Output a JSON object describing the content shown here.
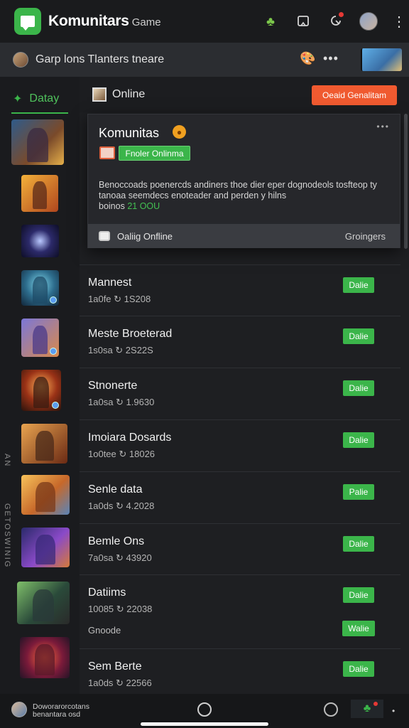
{
  "app": {
    "title": "Komunitars",
    "subtitle": "Game"
  },
  "channel": {
    "title": "Garp lons Tlanters tneare",
    "more": "•••"
  },
  "sidebar": {
    "tab_label": "Datay",
    "vertical_text_1": "AN",
    "vertical_text_2": "GETOSWINIG"
  },
  "main": {
    "header_title": "Online",
    "header_button": "Oeaid Genalitam"
  },
  "popup": {
    "title": "Komunitas",
    "badge": "Fnoler Onlinma",
    "dots": "•••",
    "desc_line1": "Benoccoads poenercds andiners thoe dier eper dognodeols tosfteop ty",
    "desc_line2": "tanoaa seemdecs enoteader and perden y hilns",
    "desc_line3_prefix": "boinos",
    "desc_line3_green": "21 OOU",
    "footer_left": "Oaliig Onfline",
    "footer_right": "Groingers"
  },
  "rows": [
    {
      "name": "Mannest",
      "meta": "1a0fe ↻ 1S208",
      "pill": "Dalie"
    },
    {
      "name": "Meste Broeterad",
      "meta": "1s0sa ↻ 2S22S",
      "pill": "Dalie"
    },
    {
      "name": "Stnonerte",
      "meta": "1a0sa ↻ 1.9630",
      "pill": "Dalie"
    },
    {
      "name": "Imoiara Dosards",
      "meta": "1o0tee ↻ 18026",
      "pill": "Dalie"
    },
    {
      "name": "Senle data",
      "meta": "1a0ds ↻ 4.2028",
      "pill": "Palie"
    },
    {
      "name": "Bemle Ons",
      "meta": "7a0sa ↻ 43920",
      "pill": "Dalie"
    },
    {
      "name": "Datiims",
      "meta": "10085 ↻ 22038",
      "pill": "Dalie",
      "extra": "Gnoode",
      "pill2": "Walie"
    },
    {
      "name": "Sem Berte",
      "meta": "1a0ds ↻ 22566",
      "pill": "Dalie"
    }
  ],
  "bottom": {
    "line1": "Doworarorcotans",
    "line2": "benantara osd"
  }
}
